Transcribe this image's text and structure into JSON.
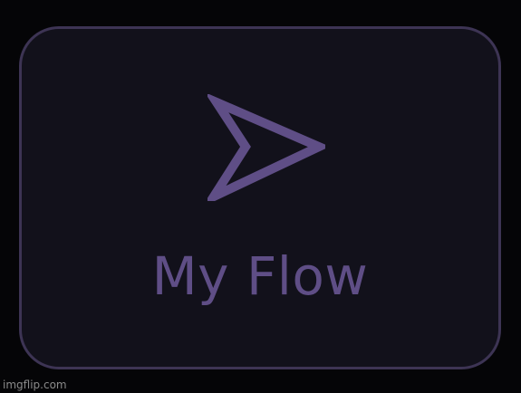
{
  "tile": {
    "label": "My Flow",
    "icon": "send-arrow-icon"
  },
  "colors": {
    "background": "#050507",
    "tile_background": "#12111b",
    "tile_border": "#3d3454",
    "accent": "#5f4e86"
  },
  "watermark": {
    "text": "imgflip.com"
  }
}
